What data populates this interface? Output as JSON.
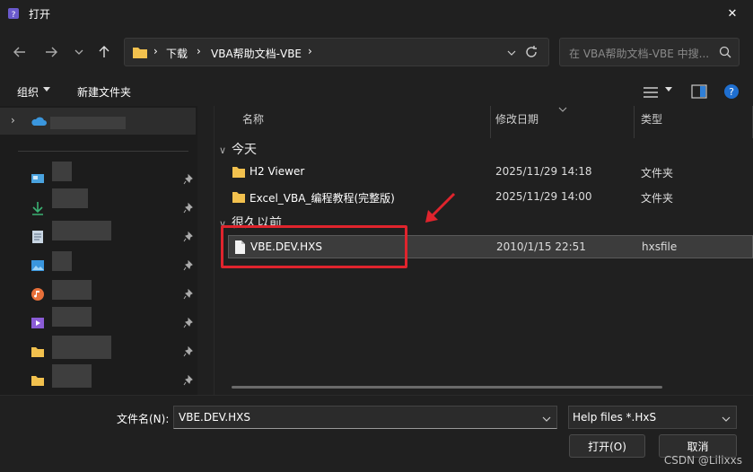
{
  "window": {
    "title": "打开",
    "close_symbol": "✕"
  },
  "nav": {
    "breadcrumb": [
      "下载",
      "VBA帮助文档-VBE"
    ],
    "search_placeholder": "在 VBA帮助文档-VBE 中搜..."
  },
  "toolbar": {
    "organize": "组织",
    "new_folder": "新建文件夹"
  },
  "columns": {
    "name": "名称",
    "modified": "修改日期",
    "type": "类型"
  },
  "groups": [
    {
      "label": "今天"
    },
    {
      "label": "很久以前"
    }
  ],
  "files": [
    {
      "name": "H2 Viewer",
      "date": "2025/11/29 14:18",
      "type": "文件夹"
    },
    {
      "name": "Excel_VBA_编程教程(完整版)",
      "date": "2025/11/29 14:00",
      "type": "文件夹"
    },
    {
      "name": "VBE.DEV.HXS",
      "date": "2010/1/15 22:51",
      "type": "hxsfile"
    }
  ],
  "bottom": {
    "filename_label": "文件名(N):",
    "filename_value": "VBE.DEV.HXS",
    "filter_value": "Help files *.HxS",
    "open_button": "打开(O)",
    "cancel_button": "取消"
  },
  "watermark": "CSDN @Lilixxs",
  "colors": {
    "folder": "#f2c14e",
    "highlight": "#e0242d",
    "accent": "#0067c0"
  }
}
